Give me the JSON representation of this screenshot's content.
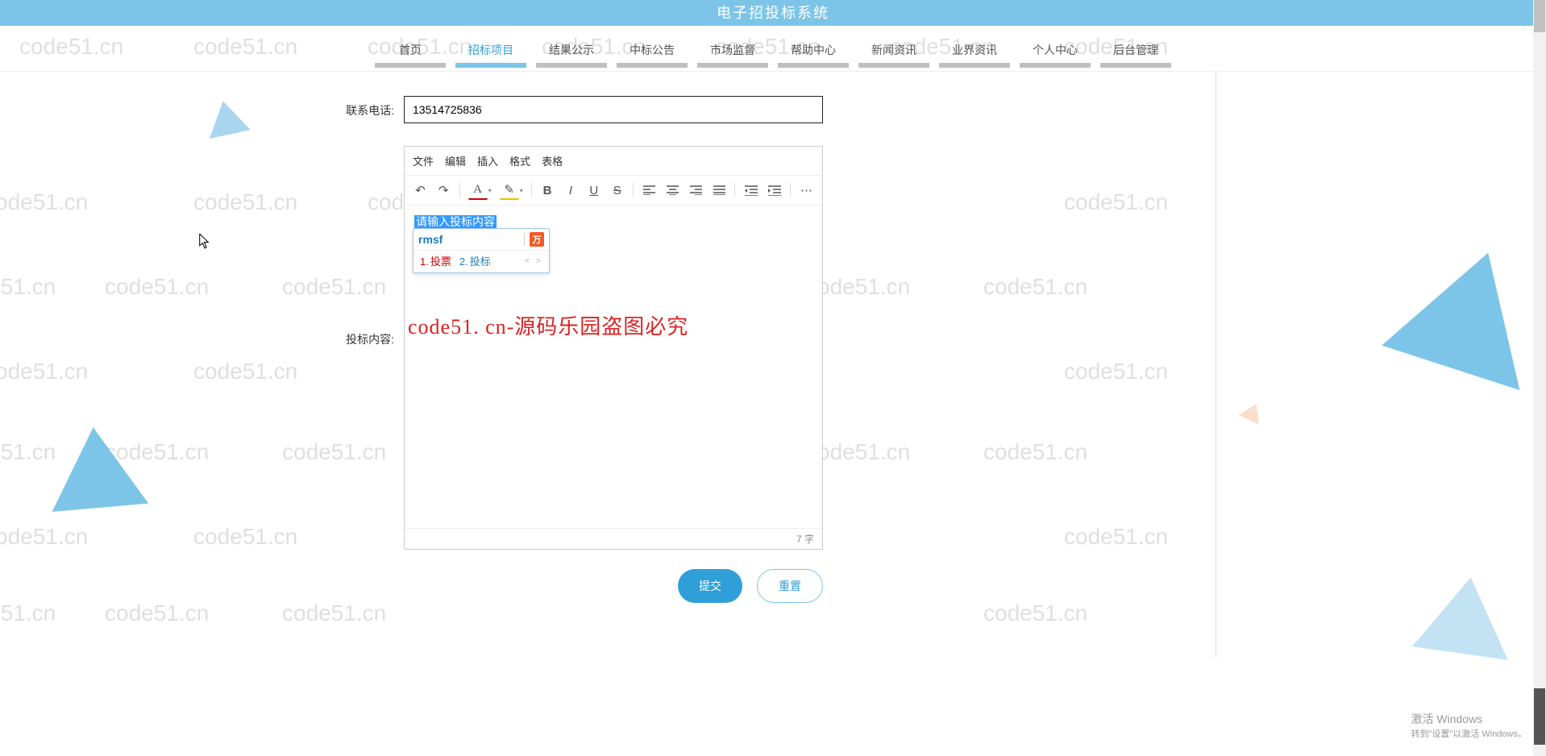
{
  "header": {
    "title": "电子招投标系统"
  },
  "nav": {
    "items": [
      {
        "label": "首页",
        "active": false
      },
      {
        "label": "招标项目",
        "active": true
      },
      {
        "label": "结果公示",
        "active": false
      },
      {
        "label": "中标公告",
        "active": false
      },
      {
        "label": "市场监督",
        "active": false
      },
      {
        "label": "帮助中心",
        "active": false
      },
      {
        "label": "新闻资讯",
        "active": false
      },
      {
        "label": "业界资讯",
        "active": false
      },
      {
        "label": "个人中心",
        "active": false
      },
      {
        "label": "后台管理",
        "active": false
      }
    ]
  },
  "form": {
    "phone_label": "联系电话:",
    "phone_value": "13514725836",
    "content_label": "投标内容:",
    "submit_label": "提交",
    "reset_label": "重置"
  },
  "editor": {
    "menu": {
      "file": "文件",
      "edit": "编辑",
      "insert": "插入",
      "format": "格式",
      "table": "表格"
    },
    "placeholder": "请输入投标内容",
    "char_count": "7 字"
  },
  "ime": {
    "input": "rmsf",
    "candidates": [
      {
        "n": "1.",
        "w": "投票"
      },
      {
        "n": "2.",
        "w": "投标"
      }
    ],
    "arrows": "< >"
  },
  "overlay_watermark": "code51. cn-源码乐园盗图必究",
  "watermark_text": "code51.cn",
  "windows": {
    "line1": "激活 Windows",
    "line2": "转到\"设置\"以激活 Windows。"
  }
}
